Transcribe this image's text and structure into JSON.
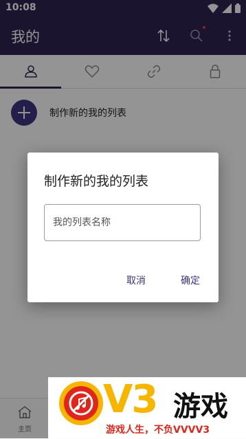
{
  "status_bar": {
    "time": "10:08"
  },
  "app_bar": {
    "title": "我的"
  },
  "list": {
    "create_label": "制作新的我的列表"
  },
  "bottom_nav": {
    "home_label": "主页"
  },
  "dialog": {
    "title": "制作新的我的列表",
    "input_value": "",
    "input_placeholder": "我的列表名称",
    "cancel_label": "取消",
    "ok_label": "确定"
  },
  "watermark": {
    "logo_text": "V3",
    "brand": "游戏",
    "slogan": "游戏人生，不负VVVV3"
  },
  "colors": {
    "primary": "#2f2452",
    "accent": "#3d3480",
    "watermark_yellow": "#f7b500",
    "watermark_red": "#e0261c"
  },
  "icons": [
    "wifi-icon",
    "signal-icon",
    "battery-icon",
    "sort-icon",
    "search-icon",
    "more-vert-icon",
    "person-icon",
    "heart-icon",
    "link-icon",
    "lock-icon",
    "plus-icon",
    "home-icon",
    "music-note-icon"
  ]
}
